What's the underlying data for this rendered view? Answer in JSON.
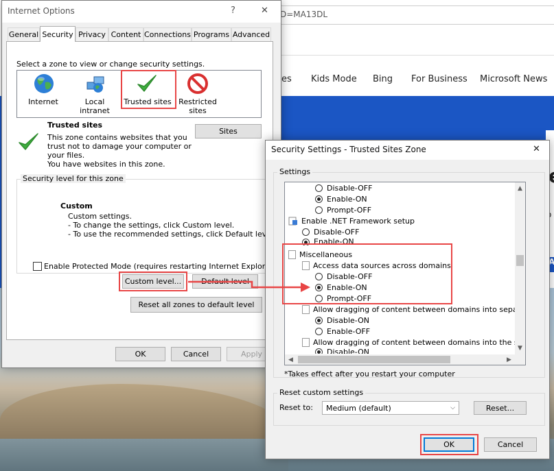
{
  "browser": {
    "address_text": "D=MA13DL",
    "nav": [
      "es",
      "Kids Mode",
      "Bing",
      "For Business",
      "Microsoft News"
    ],
    "hero_glyphs": [
      "e",
      "o",
      "AD"
    ]
  },
  "internet_options": {
    "title": "Internet Options",
    "help_glyph": "?",
    "close_glyph": "✕",
    "tabs": [
      "General",
      "Security",
      "Privacy",
      "Content",
      "Connections",
      "Programs",
      "Advanced"
    ],
    "active_tab": "Security",
    "select_zone_text": "Select a zone to view or change security settings.",
    "zones": [
      "Internet",
      "Local intranet",
      "Trusted sites",
      "Restricted sites"
    ],
    "selected_zone_title": "Trusted sites",
    "zone_desc": [
      "This zone contains websites that you",
      "trust not to damage your computer or",
      "your files.",
      "You have websites in this zone."
    ],
    "sites_button": "Sites",
    "security_level_label": "Security level for this zone",
    "custom_title": "Custom",
    "custom_desc": [
      "Custom settings.",
      "- To change the settings, click Custom level.",
      "- To use the recommended settings, click Default level."
    ],
    "protected_mode_label": "Enable Protected Mode (requires restarting Internet Explorer)",
    "custom_level_button": "Custom level...",
    "default_level_button": "Default level",
    "reset_all_button": "Reset all zones to default level",
    "ok_button": "OK",
    "cancel_button": "Cancel",
    "apply_button": "Apply"
  },
  "security_settings": {
    "title": "Security Settings - Trusted Sites Zone",
    "close_glyph": "✕",
    "settings_label": "Settings",
    "rows": [
      {
        "type": "radio",
        "label": "Disable-OFF",
        "checked": false
      },
      {
        "type": "radio",
        "label": "Enable-ON",
        "checked": true
      },
      {
        "type": "radio",
        "label": "Prompt-OFF",
        "checked": false
      },
      {
        "type": "heading",
        "label": "Enable .NET Framework setup"
      },
      {
        "type": "radio",
        "label": "Disable-OFF",
        "checked": false
      },
      {
        "type": "radio",
        "label": "Enable-ON",
        "checked": true
      },
      {
        "type": "heading",
        "label": "Miscellaneous"
      },
      {
        "type": "item",
        "label": "Access data sources across domains"
      },
      {
        "type": "radio",
        "label": "Disable-OFF",
        "checked": false
      },
      {
        "type": "radio",
        "label": "Enable-ON",
        "checked": true
      },
      {
        "type": "radio",
        "label": "Prompt-OFF",
        "checked": false
      },
      {
        "type": "item",
        "label": "Allow dragging of content between domains into separate wi"
      },
      {
        "type": "radio",
        "label": "Disable-ON",
        "checked": true
      },
      {
        "type": "radio",
        "label": "Enable-OFF",
        "checked": false
      },
      {
        "type": "item",
        "label": "Allow dragging of content between domains into the same wi"
      },
      {
        "type": "radio",
        "label": "Disable-ON",
        "checked": true
      }
    ],
    "note": "*Takes effect after you restart your computer",
    "reset_group_label": "Reset custom settings",
    "reset_to_label": "Reset to:",
    "reset_to_value": "Medium (default)",
    "reset_button": "Reset...",
    "ok_button": "OK",
    "cancel_button": "Cancel"
  },
  "colors": {
    "highlight": "#e84545",
    "accent": "#0078d7",
    "hero": "#1b56c4"
  }
}
